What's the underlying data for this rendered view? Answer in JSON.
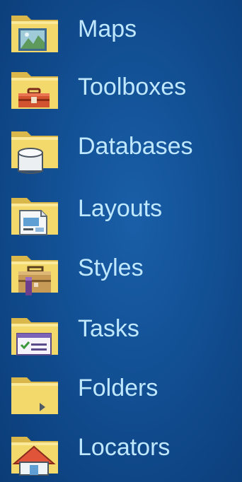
{
  "items": [
    {
      "label": "Maps",
      "icon": "folder-map-icon"
    },
    {
      "label": "Toolboxes",
      "icon": "folder-toolbox-icon"
    },
    {
      "label": "Databases",
      "icon": "folder-database-icon"
    },
    {
      "label": "Layouts",
      "icon": "folder-layout-icon"
    },
    {
      "label": "Styles",
      "icon": "folder-style-icon"
    },
    {
      "label": "Tasks",
      "icon": "folder-task-icon"
    },
    {
      "label": "Folders",
      "icon": "folder-icon"
    },
    {
      "label": "Locators",
      "icon": "folder-locator-icon"
    }
  ],
  "colors": {
    "background": "#124f93",
    "label": "#bfe8ff",
    "folder": "#f2d668",
    "folder_dark": "#c9a636"
  }
}
